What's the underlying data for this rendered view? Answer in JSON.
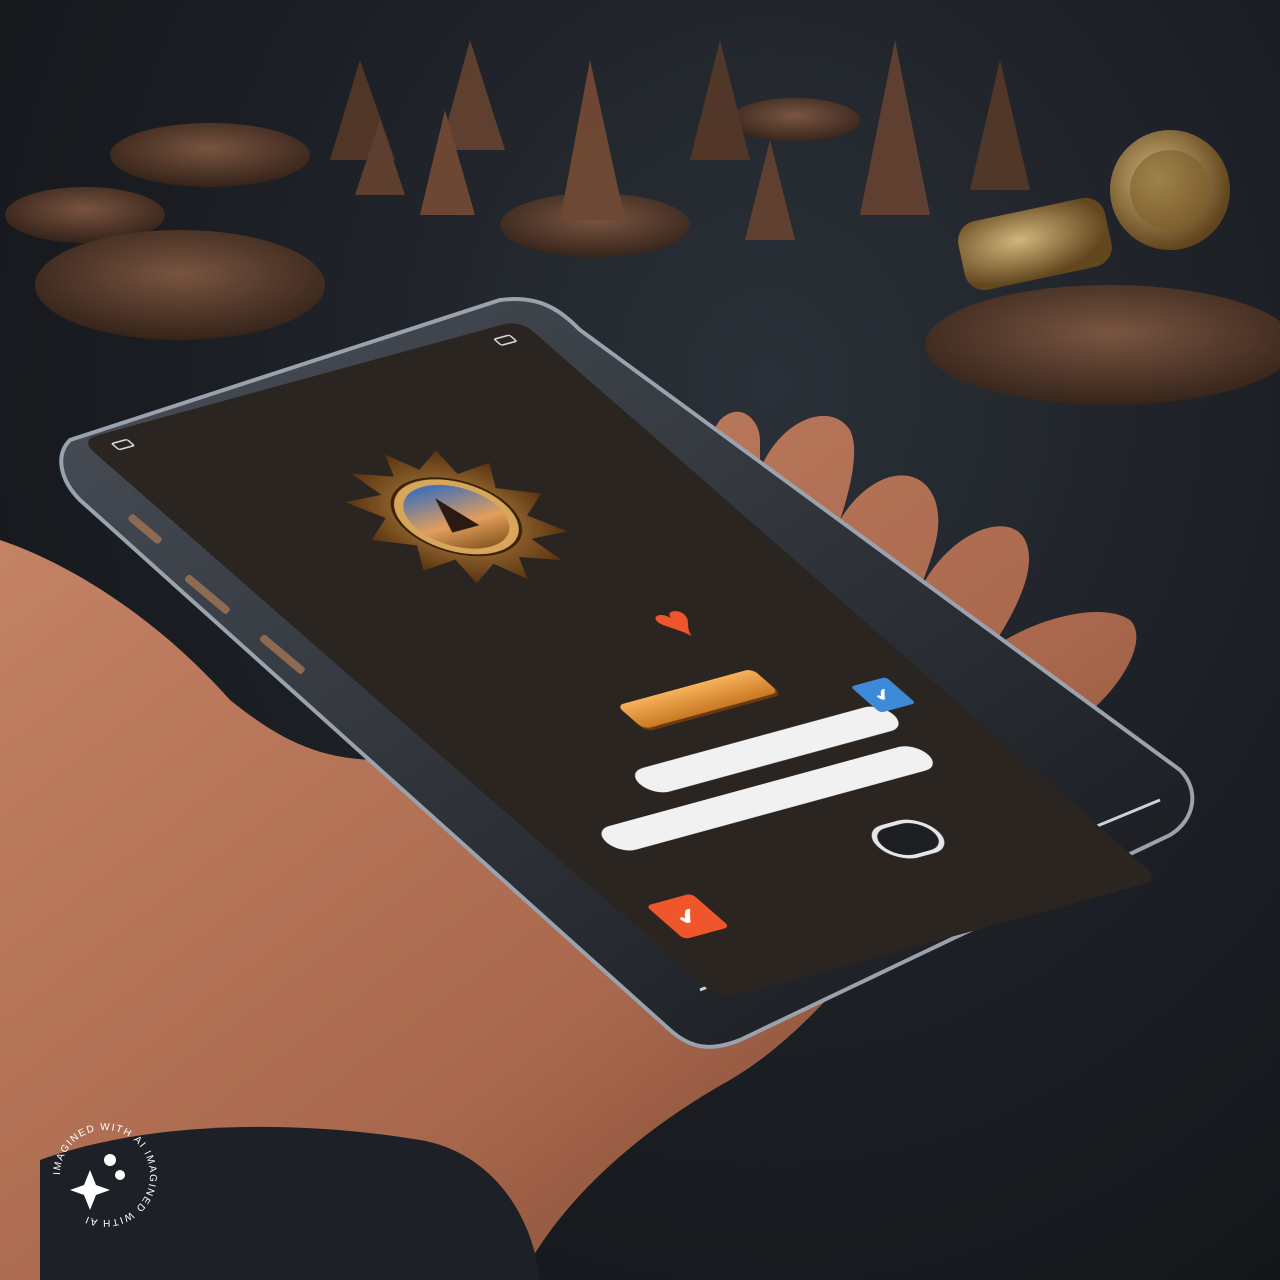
{
  "status_bar": {
    "left_text": "",
    "center_text": "",
    "right_text": ""
  },
  "screen": {
    "brand_label": "",
    "button_label": "",
    "input_1_text": "",
    "input_2_text": "",
    "heart_icon": "heart-icon",
    "check_icon": "✔"
  },
  "badge": {
    "text": "IMAGINED WITH AI IMAGINED WITH AI"
  },
  "colors": {
    "accent_orange": "#f0562b",
    "accent_blue": "#3d8bd8",
    "gold": "#d9903d"
  }
}
